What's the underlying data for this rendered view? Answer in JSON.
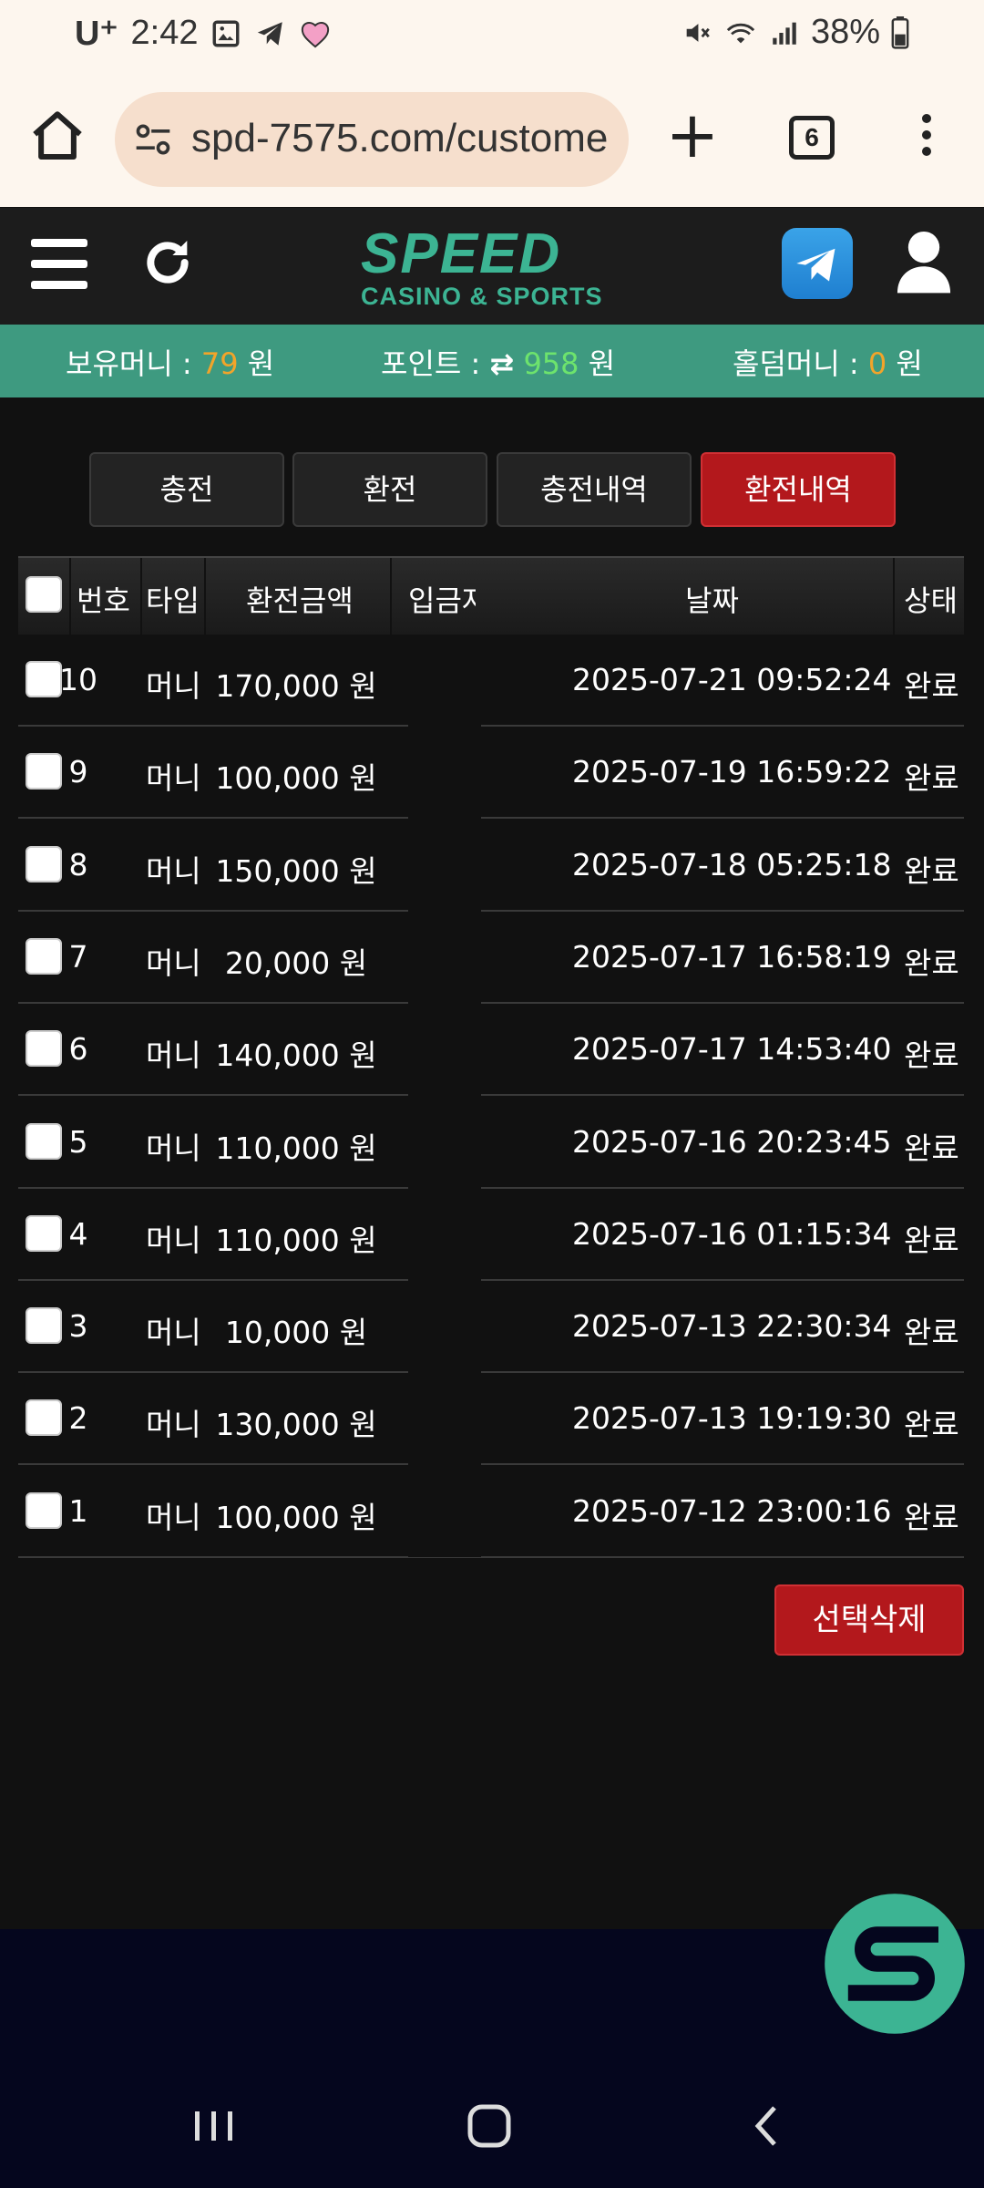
{
  "status_bar": {
    "carrier": "U⁺",
    "time": "2:42",
    "battery": "38%"
  },
  "browser": {
    "url": "spd-7575.com/custome",
    "tab_count": "6"
  },
  "site": {
    "logo_main": "SPEED",
    "logo_sub": "CASINO & SPORTS"
  },
  "balances": {
    "money_label": "보유머니 : ",
    "money_value": "79",
    "money_unit": " 원",
    "point_label": "포인트 : ",
    "point_icon": "⇄",
    "point_value": "958",
    "point_unit": " 원",
    "holdem_label": "홀덤머니 : ",
    "holdem_value": "0",
    "holdem_unit": " 원"
  },
  "tabs": [
    "충전",
    "환전",
    "충전내역",
    "환전내역"
  ],
  "table": {
    "headers": {
      "no": "번호",
      "type": "타입",
      "amount": "환전금액",
      "depositor": "입금자",
      "date": "날짜",
      "status": "상태"
    },
    "rows": [
      {
        "no": "10",
        "type": "머니",
        "amount": "170,000 원",
        "date": "2025-07-21 09:52:24",
        "status": "완료"
      },
      {
        "no": "9",
        "type": "머니",
        "amount": "100,000 원",
        "date": "2025-07-19 16:59:22",
        "status": "완료"
      },
      {
        "no": "8",
        "type": "머니",
        "amount": "150,000 원",
        "date": "2025-07-18 05:25:18",
        "status": "완료"
      },
      {
        "no": "7",
        "type": "머니",
        "amount": "20,000 원",
        "date": "2025-07-17 16:58:19",
        "status": "완료"
      },
      {
        "no": "6",
        "type": "머니",
        "amount": "140,000 원",
        "date": "2025-07-17 14:53:40",
        "status": "완료"
      },
      {
        "no": "5",
        "type": "머니",
        "amount": "110,000 원",
        "date": "2025-07-16 20:23:45",
        "status": "완료"
      },
      {
        "no": "4",
        "type": "머니",
        "amount": "110,000 원",
        "date": "2025-07-16 01:15:34",
        "status": "완료"
      },
      {
        "no": "3",
        "type": "머니",
        "amount": "10,000 원",
        "date": "2025-07-13 22:30:34",
        "status": "완료"
      },
      {
        "no": "2",
        "type": "머니",
        "amount": "130,000 원",
        "date": "2025-07-13 19:19:30",
        "status": "완료"
      },
      {
        "no": "1",
        "type": "머니",
        "amount": "100,000 원",
        "date": "2025-07-12 23:00:16",
        "status": "완료"
      }
    ]
  },
  "delete_button": "선택삭제",
  "colors": {
    "accent_green": "#3cb493",
    "balance_bar": "#3e9a80",
    "active_red": "#b3181c",
    "orange_value": "#f2a42a",
    "green_value": "#6de36d"
  }
}
